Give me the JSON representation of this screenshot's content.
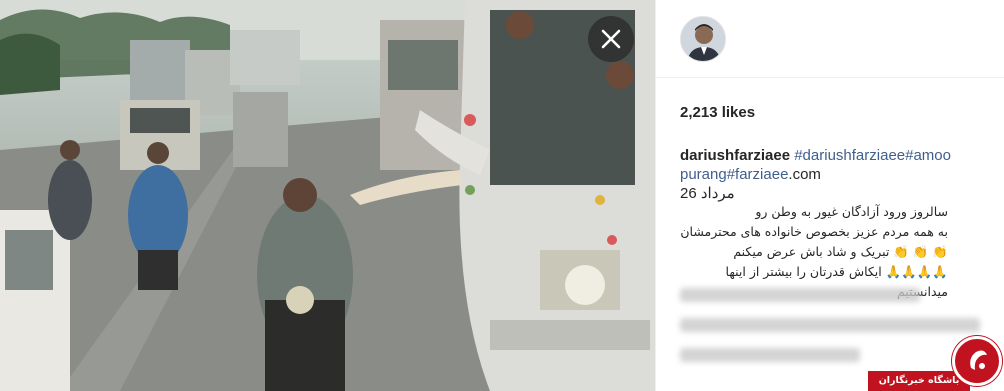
{
  "post": {
    "likes": "2,213 likes",
    "username": "dariushfarziaee",
    "hashtags_line1": "#dariushfarziaee#amoo",
    "hashtags_line2": "purang#farziaee",
    "hashtags_suffix": ".com",
    "date_line": "مرداد 26",
    "caption_lines": [
      "سالروز ورود آزادگان غیور به وطن رو",
      "به همه مردم عزیز بخصوص خانواده های محترمشان",
      "👏 👏 👏 تبریک و شاد باش عرض میکنم",
      "🙏🙏🙏🙏 ایکاش قدرتان را بیشتر از اینها میدانستیم"
    ]
  },
  "controls": {
    "close_icon": "close-icon"
  },
  "watermark": {
    "text": "باشگاه خبرنگاران",
    "color": "#c1121f"
  },
  "colors": {
    "hashtag": "#3f5f8f",
    "text": "#262626",
    "divider": "#efefef"
  }
}
